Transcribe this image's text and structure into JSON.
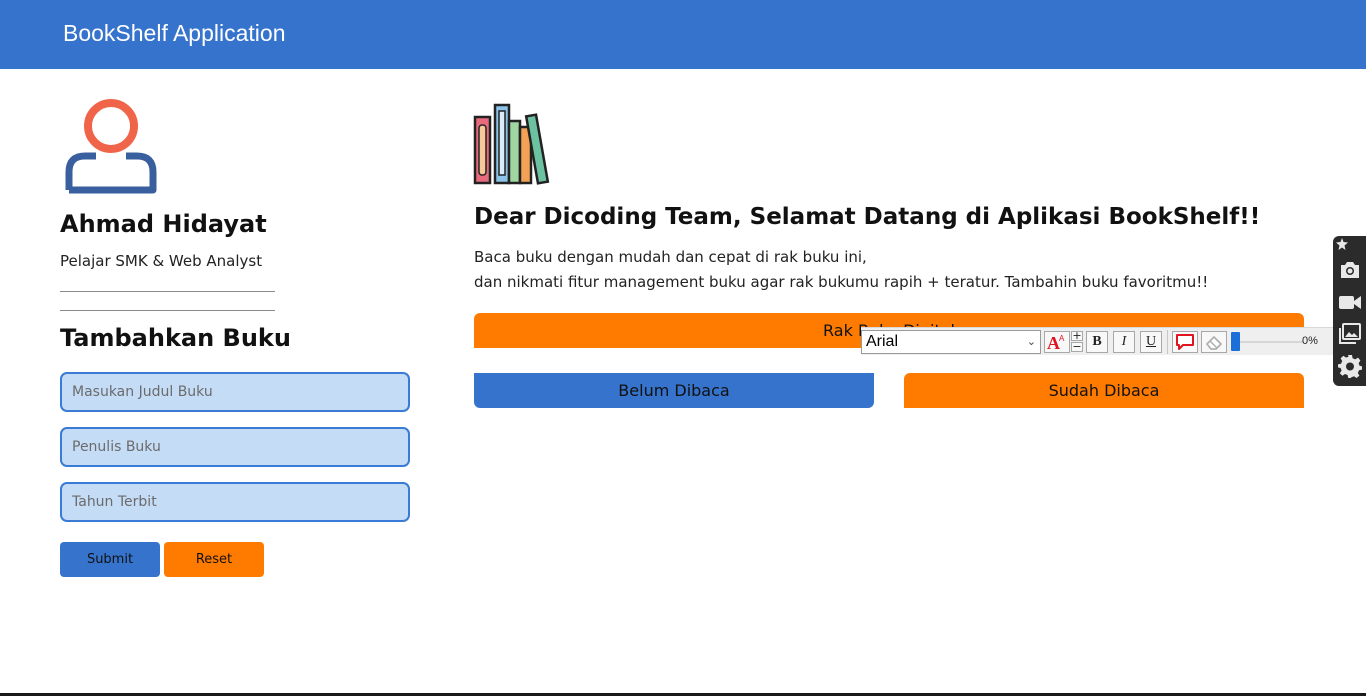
{
  "header": {
    "title": "BookShelf Application"
  },
  "profile": {
    "name": "Ahmad Hidayat",
    "role": "Pelajar SMK & Web Analyst"
  },
  "form": {
    "title": "Tambahkan Buku",
    "fields": {
      "title_placeholder": "Masukan Judul Buku",
      "author_placeholder": "Penulis Buku",
      "year_placeholder": "Tahun Terbit"
    },
    "submit_label": "Submit",
    "reset_label": "Reset"
  },
  "main": {
    "welcome": "Dear Dicoding Team, Selamat Datang di Aplikasi BookShelf!!",
    "desc_line1": "Baca buku dengan mudah dan cepat di rak buku ini,",
    "desc_line2": "dan nikmati fitur management buku agar rak bukumu rapih + teratur. Tambahin buku favoritmu!!",
    "rak_label": "Rak Buku Digital",
    "tab_unread": "Belum Dibaca",
    "tab_read": "Sudah Dibaca"
  },
  "toolbar": {
    "font_name": "Arial",
    "bold_label": "B",
    "italic_label": "I",
    "underline_label": "U",
    "slider_value": "0%",
    "icons": [
      "font-size-icon",
      "bold-icon",
      "italic-icon",
      "underline-icon",
      "comment-icon",
      "eraser-icon"
    ]
  },
  "dock": {
    "icons": [
      "pin-icon",
      "camera-icon",
      "video-icon",
      "gallery-icon",
      "gear-icon"
    ]
  },
  "colors": {
    "header_blue": "#3673cc",
    "accent_orange": "#ff7b00",
    "input_bg": "#c5dcf7"
  }
}
